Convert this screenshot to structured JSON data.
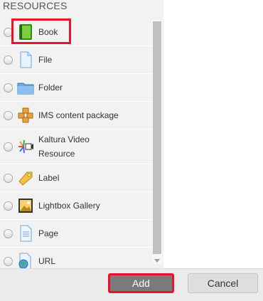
{
  "section_title": "RESOURCES",
  "items": [
    {
      "label": "Book",
      "icon": "book-icon"
    },
    {
      "label": "File",
      "icon": "file-icon"
    },
    {
      "label": "Folder",
      "icon": "folder-icon"
    },
    {
      "label": "IMS content package",
      "icon": "ims-package-icon"
    },
    {
      "label": "Kaltura Video Resource",
      "icon": "kaltura-video-icon"
    },
    {
      "label": "Label",
      "icon": "label-tag-icon"
    },
    {
      "label": "Lightbox Gallery",
      "icon": "gallery-image-icon"
    },
    {
      "label": "Page",
      "icon": "page-icon"
    },
    {
      "label": "URL",
      "icon": "url-globe-icon"
    }
  ],
  "buttons": {
    "add": "Add",
    "cancel": "Cancel"
  },
  "colors": {
    "highlight": "#e8142a",
    "add_button": "#7a7a7a",
    "panel": "#f2f2f2"
  }
}
